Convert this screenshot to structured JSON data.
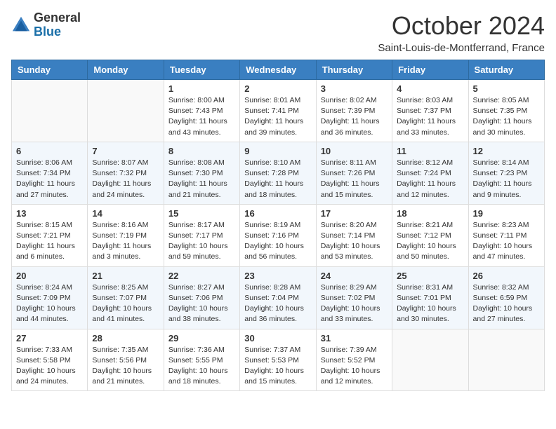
{
  "header": {
    "logo_general": "General",
    "logo_blue": "Blue",
    "month_title": "October 2024",
    "location": "Saint-Louis-de-Montferrand, France"
  },
  "weekdays": [
    "Sunday",
    "Monday",
    "Tuesday",
    "Wednesday",
    "Thursday",
    "Friday",
    "Saturday"
  ],
  "weeks": [
    [
      {
        "day": "",
        "sunrise": "",
        "sunset": "",
        "daylight": ""
      },
      {
        "day": "",
        "sunrise": "",
        "sunset": "",
        "daylight": ""
      },
      {
        "day": "1",
        "sunrise": "Sunrise: 8:00 AM",
        "sunset": "Sunset: 7:43 PM",
        "daylight": "Daylight: 11 hours and 43 minutes."
      },
      {
        "day": "2",
        "sunrise": "Sunrise: 8:01 AM",
        "sunset": "Sunset: 7:41 PM",
        "daylight": "Daylight: 11 hours and 39 minutes."
      },
      {
        "day": "3",
        "sunrise": "Sunrise: 8:02 AM",
        "sunset": "Sunset: 7:39 PM",
        "daylight": "Daylight: 11 hours and 36 minutes."
      },
      {
        "day": "4",
        "sunrise": "Sunrise: 8:03 AM",
        "sunset": "Sunset: 7:37 PM",
        "daylight": "Daylight: 11 hours and 33 minutes."
      },
      {
        "day": "5",
        "sunrise": "Sunrise: 8:05 AM",
        "sunset": "Sunset: 7:35 PM",
        "daylight": "Daylight: 11 hours and 30 minutes."
      }
    ],
    [
      {
        "day": "6",
        "sunrise": "Sunrise: 8:06 AM",
        "sunset": "Sunset: 7:34 PM",
        "daylight": "Daylight: 11 hours and 27 minutes."
      },
      {
        "day": "7",
        "sunrise": "Sunrise: 8:07 AM",
        "sunset": "Sunset: 7:32 PM",
        "daylight": "Daylight: 11 hours and 24 minutes."
      },
      {
        "day": "8",
        "sunrise": "Sunrise: 8:08 AM",
        "sunset": "Sunset: 7:30 PM",
        "daylight": "Daylight: 11 hours and 21 minutes."
      },
      {
        "day": "9",
        "sunrise": "Sunrise: 8:10 AM",
        "sunset": "Sunset: 7:28 PM",
        "daylight": "Daylight: 11 hours and 18 minutes."
      },
      {
        "day": "10",
        "sunrise": "Sunrise: 8:11 AM",
        "sunset": "Sunset: 7:26 PM",
        "daylight": "Daylight: 11 hours and 15 minutes."
      },
      {
        "day": "11",
        "sunrise": "Sunrise: 8:12 AM",
        "sunset": "Sunset: 7:24 PM",
        "daylight": "Daylight: 11 hours and 12 minutes."
      },
      {
        "day": "12",
        "sunrise": "Sunrise: 8:14 AM",
        "sunset": "Sunset: 7:23 PM",
        "daylight": "Daylight: 11 hours and 9 minutes."
      }
    ],
    [
      {
        "day": "13",
        "sunrise": "Sunrise: 8:15 AM",
        "sunset": "Sunset: 7:21 PM",
        "daylight": "Daylight: 11 hours and 6 minutes."
      },
      {
        "day": "14",
        "sunrise": "Sunrise: 8:16 AM",
        "sunset": "Sunset: 7:19 PM",
        "daylight": "Daylight: 11 hours and 3 minutes."
      },
      {
        "day": "15",
        "sunrise": "Sunrise: 8:17 AM",
        "sunset": "Sunset: 7:17 PM",
        "daylight": "Daylight: 10 hours and 59 minutes."
      },
      {
        "day": "16",
        "sunrise": "Sunrise: 8:19 AM",
        "sunset": "Sunset: 7:16 PM",
        "daylight": "Daylight: 10 hours and 56 minutes."
      },
      {
        "day": "17",
        "sunrise": "Sunrise: 8:20 AM",
        "sunset": "Sunset: 7:14 PM",
        "daylight": "Daylight: 10 hours and 53 minutes."
      },
      {
        "day": "18",
        "sunrise": "Sunrise: 8:21 AM",
        "sunset": "Sunset: 7:12 PM",
        "daylight": "Daylight: 10 hours and 50 minutes."
      },
      {
        "day": "19",
        "sunrise": "Sunrise: 8:23 AM",
        "sunset": "Sunset: 7:11 PM",
        "daylight": "Daylight: 10 hours and 47 minutes."
      }
    ],
    [
      {
        "day": "20",
        "sunrise": "Sunrise: 8:24 AM",
        "sunset": "Sunset: 7:09 PM",
        "daylight": "Daylight: 10 hours and 44 minutes."
      },
      {
        "day": "21",
        "sunrise": "Sunrise: 8:25 AM",
        "sunset": "Sunset: 7:07 PM",
        "daylight": "Daylight: 10 hours and 41 minutes."
      },
      {
        "day": "22",
        "sunrise": "Sunrise: 8:27 AM",
        "sunset": "Sunset: 7:06 PM",
        "daylight": "Daylight: 10 hours and 38 minutes."
      },
      {
        "day": "23",
        "sunrise": "Sunrise: 8:28 AM",
        "sunset": "Sunset: 7:04 PM",
        "daylight": "Daylight: 10 hours and 36 minutes."
      },
      {
        "day": "24",
        "sunrise": "Sunrise: 8:29 AM",
        "sunset": "Sunset: 7:02 PM",
        "daylight": "Daylight: 10 hours and 33 minutes."
      },
      {
        "day": "25",
        "sunrise": "Sunrise: 8:31 AM",
        "sunset": "Sunset: 7:01 PM",
        "daylight": "Daylight: 10 hours and 30 minutes."
      },
      {
        "day": "26",
        "sunrise": "Sunrise: 8:32 AM",
        "sunset": "Sunset: 6:59 PM",
        "daylight": "Daylight: 10 hours and 27 minutes."
      }
    ],
    [
      {
        "day": "27",
        "sunrise": "Sunrise: 7:33 AM",
        "sunset": "Sunset: 5:58 PM",
        "daylight": "Daylight: 10 hours and 24 minutes."
      },
      {
        "day": "28",
        "sunrise": "Sunrise: 7:35 AM",
        "sunset": "Sunset: 5:56 PM",
        "daylight": "Daylight: 10 hours and 21 minutes."
      },
      {
        "day": "29",
        "sunrise": "Sunrise: 7:36 AM",
        "sunset": "Sunset: 5:55 PM",
        "daylight": "Daylight: 10 hours and 18 minutes."
      },
      {
        "day": "30",
        "sunrise": "Sunrise: 7:37 AM",
        "sunset": "Sunset: 5:53 PM",
        "daylight": "Daylight: 10 hours and 15 minutes."
      },
      {
        "day": "31",
        "sunrise": "Sunrise: 7:39 AM",
        "sunset": "Sunset: 5:52 PM",
        "daylight": "Daylight: 10 hours and 12 minutes."
      },
      {
        "day": "",
        "sunrise": "",
        "sunset": "",
        "daylight": ""
      },
      {
        "day": "",
        "sunrise": "",
        "sunset": "",
        "daylight": ""
      }
    ]
  ]
}
